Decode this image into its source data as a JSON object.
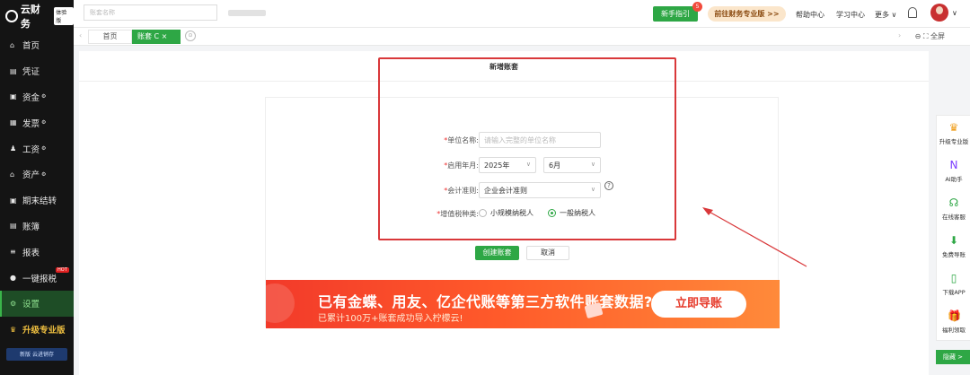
{
  "sidebar": {
    "logo_text": "云财务",
    "logo_badge": "体验版",
    "items": [
      {
        "icon": "home-icon",
        "glyph": "⌂",
        "label": "首页"
      },
      {
        "icon": "voucher-icon",
        "glyph": "▤",
        "label": "凭证"
      },
      {
        "icon": "fund-icon",
        "glyph": "▣",
        "label": "资金",
        "sup": "⚙"
      },
      {
        "icon": "invoice-icon",
        "glyph": "▦",
        "label": "发票",
        "sup": "⚙"
      },
      {
        "icon": "salary-icon",
        "glyph": "♟",
        "label": "工资",
        "sup": "⚙"
      },
      {
        "icon": "asset-icon",
        "glyph": "⌂",
        "label": "资产",
        "sup": "⚙"
      },
      {
        "icon": "period-close-icon",
        "glyph": "▣",
        "label": "期末结转"
      },
      {
        "icon": "ledger-icon",
        "glyph": "▤",
        "label": "账簿"
      },
      {
        "icon": "report-icon",
        "glyph": "≡",
        "label": "报表"
      },
      {
        "icon": "one-click-tax-icon",
        "glyph": "●",
        "label": "一键报税",
        "hot": "HOT"
      },
      {
        "icon": "settings-icon",
        "glyph": "⚙",
        "label": "设置",
        "active": true
      },
      {
        "icon": "crown-icon",
        "glyph": "♛",
        "label": "升级专业版"
      }
    ],
    "promo_text": "新版 云进销存"
  },
  "topbar": {
    "account_placeholder": "账套名称",
    "guide_label": "新手指引",
    "guide_badge": "5",
    "pro_label": "前往财务专业版 >>",
    "help": "帮助中心",
    "learn": "学习中心",
    "more": "更多 ∨"
  },
  "tabs": {
    "home": "首页",
    "active": "账套 C ×",
    "fullscreen": "全屏"
  },
  "page": {
    "title": "新增账套"
  },
  "form": {
    "name_label": "单位名称:",
    "name_placeholder": "请输入完整的单位名称",
    "month_label": "启用年月:",
    "year_value": "2025年",
    "month_value": "6月",
    "standard_label": "会计准则:",
    "standard_value": "企业会计准则",
    "vat_label": "增值税种类:",
    "vat_option_small": "小规模纳税人",
    "vat_option_general": "一般纳税人",
    "vat_selected": "一般纳税人",
    "create_button": "创建账套",
    "cancel_button": "取消"
  },
  "banner": {
    "main_text": "已有金蝶、用友、亿企代账等第三方软件账套数据?",
    "sub_text": "已累计100万+账套成功导入柠檬云!",
    "button": "立即导账"
  },
  "float_panel": [
    {
      "icon": "crown-icon",
      "glyph": "♛",
      "label": "升级专业版",
      "color": "#f0a020"
    },
    {
      "icon": "ai-assistant-icon",
      "glyph": "N",
      "label": "AI助手",
      "color": "#7a3cff"
    },
    {
      "icon": "headset-icon",
      "glyph": "☊",
      "label": "在线客服",
      "color": "#2ea745"
    },
    {
      "icon": "download-icon",
      "glyph": "⬇",
      "label": "免费导账",
      "color": "#2ea745"
    },
    {
      "icon": "phone-icon",
      "glyph": "▯",
      "label": "下载APP",
      "color": "#2ea745"
    },
    {
      "icon": "gift-icon",
      "glyph": "🎁",
      "label": "福利领取",
      "color": "#f0a020"
    }
  ],
  "float_hide": "隐藏 >",
  "colors": {
    "accent": "#2ea745",
    "sidebar_bg": "#141414",
    "annotation": "#d9383a"
  }
}
